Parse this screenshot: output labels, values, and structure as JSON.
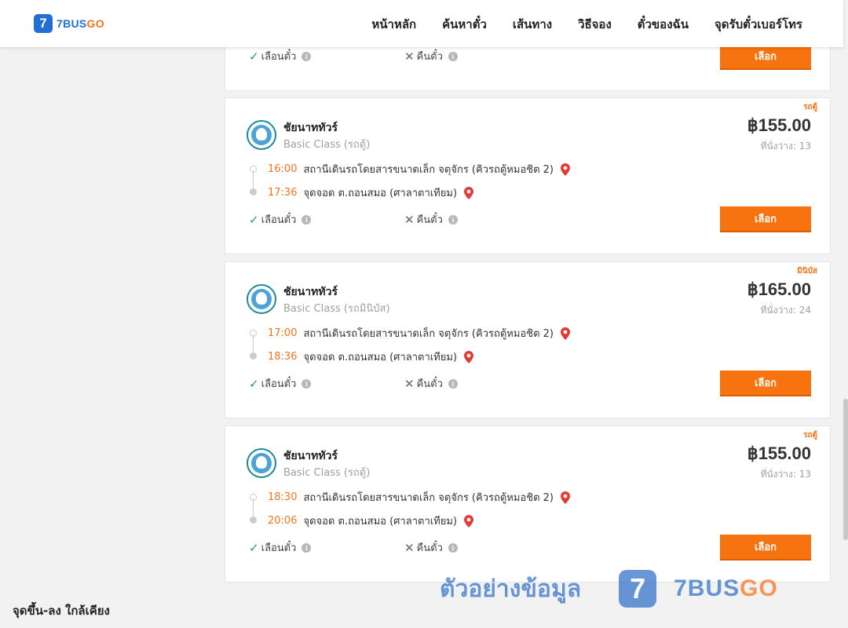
{
  "header": {
    "logo_mark": "7",
    "logo_text_a": "7BUS",
    "logo_text_b": "GO",
    "nav": [
      "หน้าหลัก",
      "ค้นหาตั๋ว",
      "เส้นทาง",
      "วิธีจอง",
      "ตั๋วของฉัน",
      "จุดรับตั๋วเบอร์โทร"
    ]
  },
  "common": {
    "seat_select": "เลือนตั๋ว",
    "refund": "คืนตั๋ว",
    "select_button": "เลือก",
    "info_icon": "i"
  },
  "trips": [
    {
      "tag": "รถตู้",
      "operator": "ชัยนาททัวร์",
      "class": "Basic Class (รถตู้)",
      "price": "฿155.00",
      "seats": "ที่นั่งว่าง: 13",
      "dep_time": "16:00",
      "dep_place": "สถานีเดินรถโดยสารขนาดเล็ก จตุจักร (คิวรถตู้หมอชิต 2)",
      "arr_time": "17:36",
      "arr_place": "จุดจอด ต.ถอนสมอ (ศาลาตาเทียม)"
    },
    {
      "tag": "มินิบัส",
      "operator": "ชัยนาททัวร์",
      "class": "Basic Class (รถมินิบัส)",
      "price": "฿165.00",
      "seats": "ที่นั่งว่าง: 24",
      "dep_time": "17:00",
      "dep_place": "สถานีเดินรถโดยสารขนาดเล็ก จตุจักร (คิวรถตู้หมอชิต 2)",
      "arr_time": "18:36",
      "arr_place": "จุดจอด ต.ถอนสมอ (ศาลาตาเทียม)"
    },
    {
      "tag": "รถตู้",
      "operator": "ชัยนาททัวร์",
      "class": "Basic Class (รถตู้)",
      "price": "฿155.00",
      "seats": "ที่นั่งว่าง: 13",
      "dep_time": "18:30",
      "dep_place": "สถานีเดินรถโดยสารขนาดเล็ก จตุจักร (คิวรถตู้หมอชิต 2)",
      "arr_time": "20:06",
      "arr_place": "จุดจอด ต.ถอนสมอ (ศาลาตาเทียม)"
    }
  ],
  "nearby_title": "จุดขึ้น-ลง ใกล้เคียง",
  "watermark": {
    "text": "ตัวอย่างข้อมูล",
    "mark": "7",
    "brand_a": "7BUS",
    "brand_b": "GO"
  },
  "colors": {
    "accent": "#f7730f",
    "brand_blue": "#1f6fd6",
    "time_orange": "#f7731c",
    "check_green": "#27a844"
  }
}
